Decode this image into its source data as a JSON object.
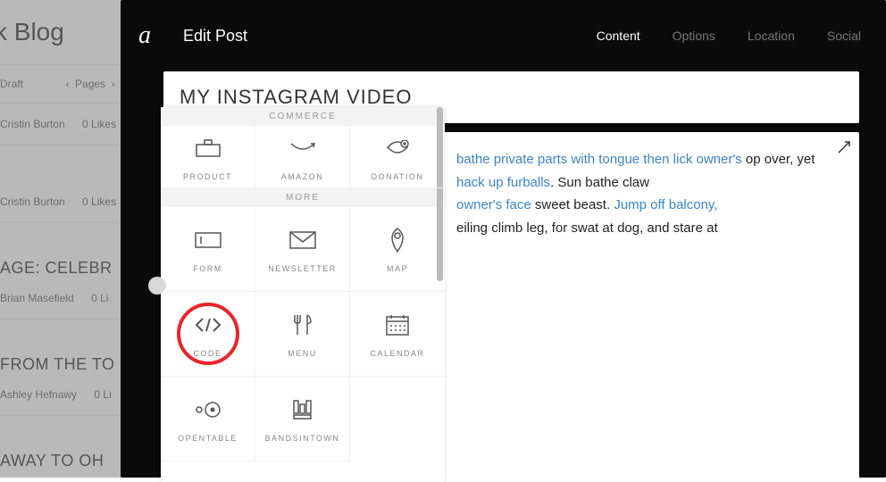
{
  "background": {
    "title": "ck Blog",
    "statusRow": {
      "draft": "Draft",
      "pages": "Pages"
    },
    "posts": [
      {
        "author": "Cristin Burton",
        "likes": "0 Likes"
      },
      {
        "author": "Cristin Burton",
        "likes": "0 Likes"
      }
    ],
    "headings": [
      {
        "text": "AGE: CELEBR",
        "author": "Brian Masefield",
        "likes": "0 Li"
      },
      {
        "text": "FROM THE TO",
        "author": "Ashley Hefnawy",
        "likes": "0 Li"
      },
      {
        "text": "AWAY TO OH",
        "author": "",
        "likes": ""
      }
    ]
  },
  "modal": {
    "logo": "a",
    "title": "Edit Post",
    "tabs": [
      {
        "label": "Content",
        "active": true
      },
      {
        "label": "Options",
        "active": false
      },
      {
        "label": "Location",
        "active": false
      },
      {
        "label": "Social",
        "active": false
      }
    ],
    "postTitle": "MY INSTAGRAM VIDEO",
    "body": {
      "parts": [
        {
          "type": "link",
          "text": "bathe private parts with tongue then lick owner's"
        },
        {
          "type": "text",
          "text": " op over, yet "
        },
        {
          "type": "link",
          "text": "hack up furballs"
        },
        {
          "type": "text",
          "text": ". Sun bathe claw "
        },
        {
          "type": "link",
          "text": "owner's face"
        },
        {
          "type": "text",
          "text": " sweet beast. "
        },
        {
          "type": "link",
          "text": "Jump off balcony,"
        },
        {
          "type": "text",
          "text": " eiling climb leg, for swat at dog, and stare at"
        }
      ]
    }
  },
  "picker": {
    "sections": [
      {
        "label": "COMMERCE",
        "blocks": [
          {
            "id": "product",
            "label": "PRODUCT"
          },
          {
            "id": "amazon",
            "label": "AMAZON"
          },
          {
            "id": "donation",
            "label": "DONATION"
          }
        ]
      },
      {
        "label": "MORE",
        "blocks": [
          {
            "id": "form",
            "label": "FORM"
          },
          {
            "id": "newsletter",
            "label": "NEWSLETTER"
          },
          {
            "id": "map",
            "label": "MAP"
          },
          {
            "id": "code",
            "label": "CODE",
            "highlighted": true
          },
          {
            "id": "menu",
            "label": "MENU"
          },
          {
            "id": "calendar",
            "label": "CALENDAR"
          },
          {
            "id": "opentable",
            "label": "OPENTABLE"
          },
          {
            "id": "bandsintown",
            "label": "BANDSINTOWN"
          }
        ]
      }
    ]
  }
}
